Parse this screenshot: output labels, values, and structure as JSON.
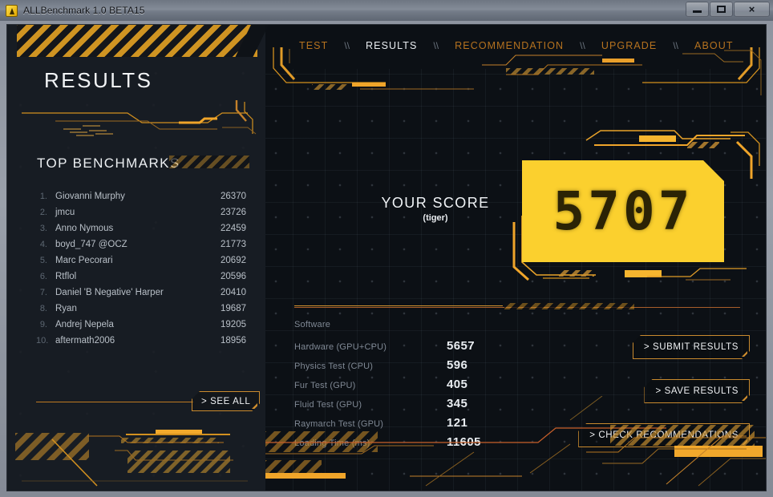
{
  "window": {
    "title": "ALLBenchmark 1.0 BETA15",
    "app_icon": "app-triangle-icon",
    "minimize_label": "",
    "maximize_label": "",
    "close_label": "×"
  },
  "sidebar": {
    "page_title": "RESULTS",
    "section_title": "TOP BENCHMARKS",
    "see_all_label": "> SEE ALL",
    "benchmarks": [
      {
        "rank": "1.",
        "name": "Giovanni Murphy",
        "score": "26370"
      },
      {
        "rank": "2.",
        "name": "jmcu",
        "score": "23726"
      },
      {
        "rank": "3.",
        "name": "Anno Nymous",
        "score": "22459"
      },
      {
        "rank": "4.",
        "name": "boyd_747 @OCZ",
        "score": "21773"
      },
      {
        "rank": "5.",
        "name": "Marc Pecorari",
        "score": "20692"
      },
      {
        "rank": "6.",
        "name": "Rtflol",
        "score": "20596"
      },
      {
        "rank": "7.",
        "name": "Daniel 'B Negative' Harper",
        "score": "20410"
      },
      {
        "rank": "8.",
        "name": "Ryan",
        "score": "19687"
      },
      {
        "rank": "9.",
        "name": "Andrej Nepela",
        "score": "19205"
      },
      {
        "rank": "10.",
        "name": "aftermath2006",
        "score": "18956"
      }
    ]
  },
  "nav": {
    "items": [
      {
        "label": "TEST",
        "active": false
      },
      {
        "label": "RESULTS",
        "active": true
      },
      {
        "label": "RECOMMENDATION",
        "active": false
      },
      {
        "label": "UPGRADE",
        "active": false
      },
      {
        "label": "ABOUT",
        "active": false
      }
    ],
    "separator": "\\\\"
  },
  "score": {
    "label": "YOUR SCORE",
    "preset": "(tiger)",
    "value": "5707"
  },
  "stats": [
    {
      "label": "Software",
      "value": ""
    },
    {
      "label": "Hardware (GPU+CPU)",
      "value": "5657"
    },
    {
      "label": "Physics Test (CPU)",
      "value": "596"
    },
    {
      "label": "Fur Test (GPU)",
      "value": "405"
    },
    {
      "label": "Fluid Test (GPU)",
      "value": "345"
    },
    {
      "label": "Raymarch Test (GPU)",
      "value": "121"
    },
    {
      "label": "Loading Time (ms)",
      "value": "11605"
    }
  ],
  "actions": [
    {
      "label": "> SUBMIT RESULTS"
    },
    {
      "label": "> SAVE RESULTS"
    },
    {
      "label": "> CHECK RECOMMENDATIONS"
    }
  ],
  "colors": {
    "accent_orange": "#d2901f",
    "accent_yellow": "#fbd02e",
    "panel_dark": "#0c1015",
    "sidebar_dark": "#171c23",
    "text_light": "#e9edf1",
    "text_muted": "#7f8894"
  }
}
